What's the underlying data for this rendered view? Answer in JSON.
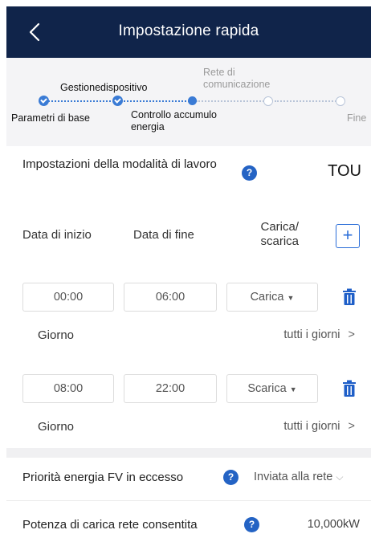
{
  "header": {
    "title": "Impostazione rapida"
  },
  "stepper": {
    "steps": [
      {
        "label": "Parametri di base",
        "status": "done"
      },
      {
        "label": "Gestionedispositivo",
        "status": "done"
      },
      {
        "label": "Controllo accumulo energia",
        "status": "current"
      },
      {
        "label": "Rete di comunicazione",
        "status": "todo"
      },
      {
        "label": "Fine",
        "status": "todo"
      }
    ]
  },
  "mode": {
    "label": "Impostazioni della modalità di lavoro",
    "help": "?",
    "value": "TOU"
  },
  "schedule": {
    "columns": {
      "start": "Data di inizio",
      "end": "Data di fine",
      "charge": "Carica/ scarica"
    },
    "add": "+",
    "rows": [
      {
        "start": "00:00",
        "end": "06:00",
        "type": "Carica",
        "day_label": "Giorno",
        "day_value": "tutti i giorni"
      },
      {
        "start": "08:00",
        "end": "22:00",
        "type": "Scarica",
        "day_label": "Giorno",
        "day_value": "tutti i giorni"
      }
    ]
  },
  "priority": {
    "label": "Priorità energia FV in eccesso",
    "help": "?",
    "value": "Inviata alla rete"
  },
  "grid_charge": {
    "label": "Potenza di carica rete consentita",
    "help": "?",
    "value": "10,000kW"
  },
  "colors": {
    "header_bg": "#10244a",
    "accent": "#2463c4",
    "stepper_bg": "#f4f4f6"
  }
}
